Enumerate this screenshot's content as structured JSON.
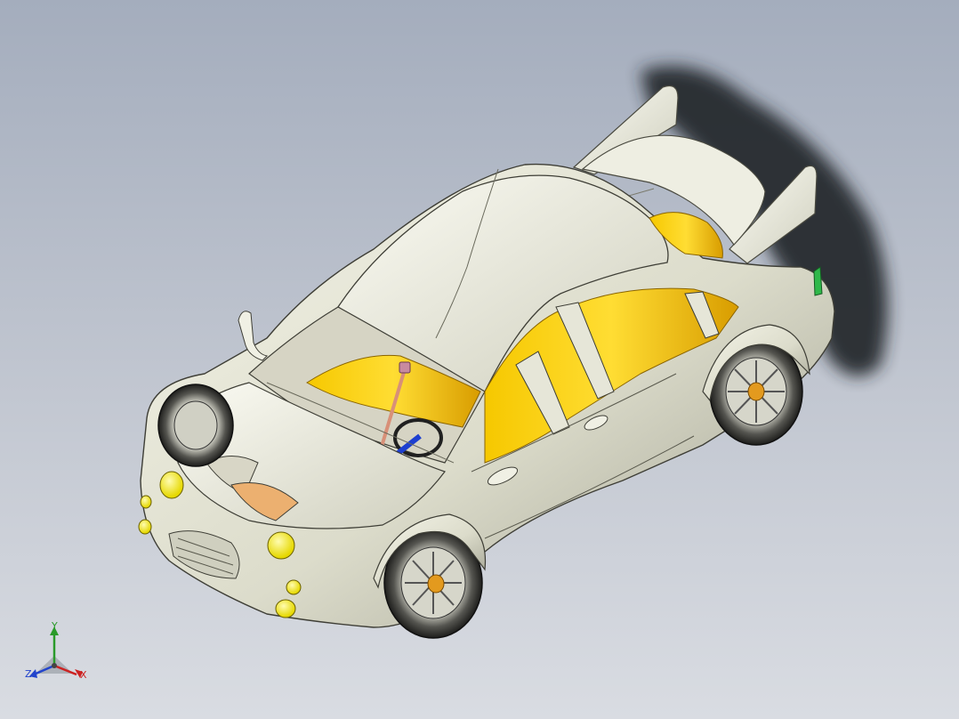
{
  "viewport": {
    "background_top": "#a4adbd",
    "background_bottom": "#d9dce2"
  },
  "model": {
    "body_color": "#e4e4d4",
    "interior_color": "#f2c000",
    "light_color": "#f7ee18",
    "shadow_color": "#2a2c33",
    "hub_color": "#e39a1e"
  },
  "triad": {
    "x_label": "X",
    "y_label": "Y",
    "z_label": "Z",
    "x_color": "#cc2222",
    "y_color": "#2a9a2a",
    "z_color": "#2244cc"
  }
}
